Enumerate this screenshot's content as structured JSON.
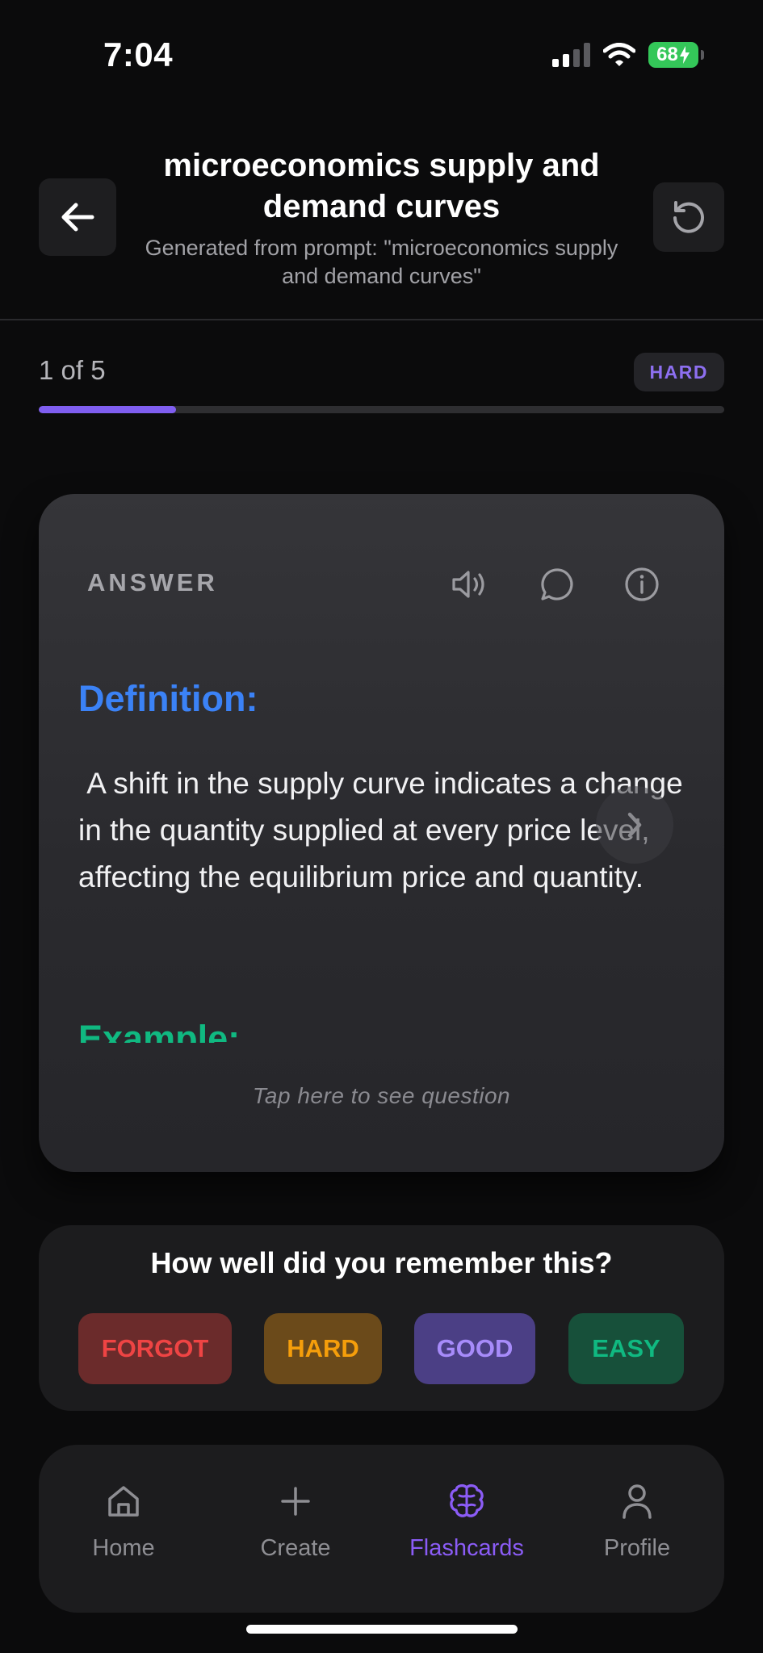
{
  "status_bar": {
    "time": "7:04",
    "battery": "68"
  },
  "header": {
    "title": "microeconomics supply and demand curves",
    "subtitle": "Generated from prompt: \"microeconomics supply and demand curves\""
  },
  "progress": {
    "label": "1 of 5",
    "difficulty": "HARD",
    "fraction": 0.2
  },
  "card": {
    "label": "ANSWER",
    "icons": [
      "speaker-icon",
      "chat-bubble-icon",
      "info-icon"
    ],
    "definition_heading": "Definition:",
    "definition_text": " A shift in the supply curve indicates a change in the quantity supplied at every price level, affecting the equilibrium price and quantity.",
    "example_heading": "Example:",
    "tap_hint": "Tap here to see question"
  },
  "rating": {
    "title": "How well did you remember this?",
    "buttons": {
      "forgot": "FORGOT",
      "hard": "HARD",
      "good": "GOOD",
      "easy": "EASY"
    }
  },
  "tabs": [
    {
      "label": "Home",
      "icon": "home-icon"
    },
    {
      "label": "Create",
      "icon": "plus-icon"
    },
    {
      "label": "Flashcards",
      "icon": "brain-icon",
      "active": true
    },
    {
      "label": "Profile",
      "icon": "person-icon"
    }
  ],
  "colors": {
    "accent": "#8b5cf6",
    "definition": "#3b82f6",
    "example": "#10b981",
    "forgot": "#ef4444",
    "hard": "#f59e0b",
    "good": "#a78bfa",
    "easy": "#10b981"
  }
}
